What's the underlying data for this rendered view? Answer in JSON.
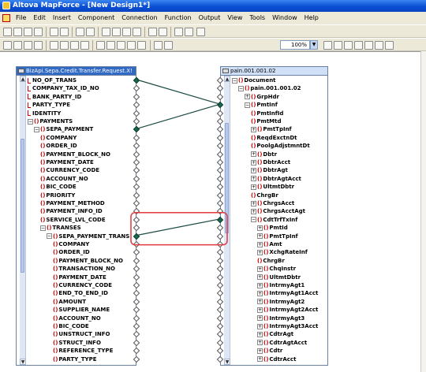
{
  "window": {
    "title": "Altova MapForce - [New Design1*]"
  },
  "menu": [
    "File",
    "Edit",
    "Insert",
    "Component",
    "Connection",
    "Function",
    "Output",
    "View",
    "Tools",
    "Window",
    "Help"
  ],
  "toolbar": {
    "zoom": "100%"
  },
  "source": {
    "title": "BizApi.Sepa.Credit.Transfer.Request.X!",
    "rows": [
      {
        "label": "NO_OF_TRANS",
        "kind": "attr",
        "ind": 0
      },
      {
        "label": "COMPANY_TAX_ID_NO",
        "kind": "attr",
        "ind": 0
      },
      {
        "label": "BANK_PARTY_ID",
        "kind": "attr",
        "ind": 0
      },
      {
        "label": "PARTY_TYPE",
        "kind": "attr",
        "ind": 0
      },
      {
        "label": "IDENTITY",
        "kind": "attr",
        "ind": 0
      },
      {
        "label": "PAYMENTS",
        "kind": "elem",
        "ind": 0,
        "toggle": "-"
      },
      {
        "label": "SEPA_PAYMENT",
        "kind": "elem",
        "ind": 1,
        "toggle": "-"
      },
      {
        "label": "COMPANY",
        "kind": "elem",
        "ind": 2
      },
      {
        "label": "ORDER_ID",
        "kind": "elem",
        "ind": 2
      },
      {
        "label": "PAYMENT_BLOCK_NO",
        "kind": "elem",
        "ind": 2
      },
      {
        "label": "PAYMENT_DATE",
        "kind": "elem",
        "ind": 2
      },
      {
        "label": "CURRENCY_CODE",
        "kind": "elem",
        "ind": 2
      },
      {
        "label": "ACCOUNT_NO",
        "kind": "elem",
        "ind": 2
      },
      {
        "label": "BIC_CODE",
        "kind": "elem",
        "ind": 2
      },
      {
        "label": "PRIORITY",
        "kind": "elem",
        "ind": 2
      },
      {
        "label": "PAYMENT_METHOD",
        "kind": "elem",
        "ind": 2
      },
      {
        "label": "PAYMENT_INFO_ID",
        "kind": "elem",
        "ind": 2
      },
      {
        "label": "SERVICE_LVL_CODE",
        "kind": "elem",
        "ind": 2
      },
      {
        "label": "TRANSES",
        "kind": "elem",
        "ind": 2,
        "toggle": "-"
      },
      {
        "label": "SEPA_PAYMENT_TRANS",
        "kind": "elem",
        "ind": 3,
        "toggle": "-"
      },
      {
        "label": "COMPANY",
        "kind": "elem",
        "ind": 4
      },
      {
        "label": "ORDER_ID",
        "kind": "elem",
        "ind": 4
      },
      {
        "label": "PAYMENT_BLOCK_NO",
        "kind": "elem",
        "ind": 4
      },
      {
        "label": "TRANSACTION_NO",
        "kind": "elem",
        "ind": 4
      },
      {
        "label": "PAYMENT_DATE",
        "kind": "elem",
        "ind": 4
      },
      {
        "label": "CURRENCY_CODE",
        "kind": "elem",
        "ind": 4
      },
      {
        "label": "END_TO_END_ID",
        "kind": "elem",
        "ind": 4
      },
      {
        "label": "AMOUNT",
        "kind": "elem",
        "ind": 4
      },
      {
        "label": "SUPPLIER_NAME",
        "kind": "elem",
        "ind": 4
      },
      {
        "label": "ACCOUNT_NO",
        "kind": "elem",
        "ind": 4
      },
      {
        "label": "BIC_CODE",
        "kind": "elem",
        "ind": 4
      },
      {
        "label": "UNSTRUCT_INFO",
        "kind": "elem",
        "ind": 4
      },
      {
        "label": "STRUCT_INFO",
        "kind": "elem",
        "ind": 4
      },
      {
        "label": "REFERENCE_TYPE",
        "kind": "elem",
        "ind": 4
      },
      {
        "label": "PARTY_TYPE",
        "kind": "elem",
        "ind": 4
      }
    ]
  },
  "target": {
    "title": "pain.001.001.02",
    "rows": [
      {
        "label": "Document",
        "kind": "elem",
        "ind": 0,
        "toggle": "-"
      },
      {
        "label": "pain.001.001.02",
        "kind": "elem",
        "ind": 1,
        "toggle": "-"
      },
      {
        "label": "GrpHdr",
        "kind": "elem",
        "ind": 2,
        "toggle": "+"
      },
      {
        "label": "PmtInf",
        "kind": "elem",
        "ind": 2,
        "toggle": "-"
      },
      {
        "label": "PmtInfId",
        "kind": "elem",
        "ind": 3
      },
      {
        "label": "PmtMtd",
        "kind": "elem",
        "ind": 3
      },
      {
        "label": "PmtTpInf",
        "kind": "elem",
        "ind": 3,
        "toggle": "+"
      },
      {
        "label": "ReqdExctnDt",
        "kind": "elem",
        "ind": 3
      },
      {
        "label": "PoolgAdjstmntDt",
        "kind": "elem",
        "ind": 3
      },
      {
        "label": "Dbtr",
        "kind": "elem",
        "ind": 3,
        "toggle": "+"
      },
      {
        "label": "DbtrAcct",
        "kind": "elem",
        "ind": 3,
        "toggle": "+"
      },
      {
        "label": "DbtrAgt",
        "kind": "elem",
        "ind": 3,
        "toggle": "+"
      },
      {
        "label": "DbtrAgtAcct",
        "kind": "elem",
        "ind": 3,
        "toggle": "+"
      },
      {
        "label": "UltmtDbtr",
        "kind": "elem",
        "ind": 3,
        "toggle": "+"
      },
      {
        "label": "ChrgBr",
        "kind": "elem",
        "ind": 3
      },
      {
        "label": "ChrgsAcct",
        "kind": "elem",
        "ind": 3,
        "toggle": "+"
      },
      {
        "label": "ChrgsAcctAgt",
        "kind": "elem",
        "ind": 3,
        "toggle": "+"
      },
      {
        "label": "CdtTrfTxInf",
        "kind": "elem",
        "ind": 3,
        "toggle": "-"
      },
      {
        "label": "PmtId",
        "kind": "elem",
        "ind": 4,
        "toggle": "+"
      },
      {
        "label": "PmtTpInf",
        "kind": "elem",
        "ind": 4,
        "toggle": "+"
      },
      {
        "label": "Amt",
        "kind": "elem",
        "ind": 4,
        "toggle": "+"
      },
      {
        "label": "XchgRateInf",
        "kind": "elem",
        "ind": 4,
        "toggle": "+"
      },
      {
        "label": "ChrgBr",
        "kind": "elem",
        "ind": 4
      },
      {
        "label": "ChqInstr",
        "kind": "elem",
        "ind": 4,
        "toggle": "+"
      },
      {
        "label": "UltmtDbtr",
        "kind": "elem",
        "ind": 4,
        "toggle": "+"
      },
      {
        "label": "IntrmyAgt1",
        "kind": "elem",
        "ind": 4,
        "toggle": "+"
      },
      {
        "label": "IntrmyAgt1Acct",
        "kind": "elem",
        "ind": 4,
        "toggle": "+"
      },
      {
        "label": "IntrmyAgt2",
        "kind": "elem",
        "ind": 4,
        "toggle": "+"
      },
      {
        "label": "IntrmyAgt2Acct",
        "kind": "elem",
        "ind": 4,
        "toggle": "+"
      },
      {
        "label": "IntrmyAgt3",
        "kind": "elem",
        "ind": 4,
        "toggle": "+"
      },
      {
        "label": "IntrmyAgt3Acct",
        "kind": "elem",
        "ind": 4,
        "toggle": "+"
      },
      {
        "label": "CdtrAgt",
        "kind": "elem",
        "ind": 4,
        "toggle": "+"
      },
      {
        "label": "CdtrAgtAcct",
        "kind": "elem",
        "ind": 4,
        "toggle": "+"
      },
      {
        "label": "Cdtr",
        "kind": "elem",
        "ind": 4,
        "toggle": "+"
      },
      {
        "label": "CdtrAcct",
        "kind": "elem",
        "ind": 4,
        "toggle": "+"
      }
    ]
  },
  "highlight": {
    "color": "#e0393e"
  },
  "wire_color": "#1c4b44"
}
